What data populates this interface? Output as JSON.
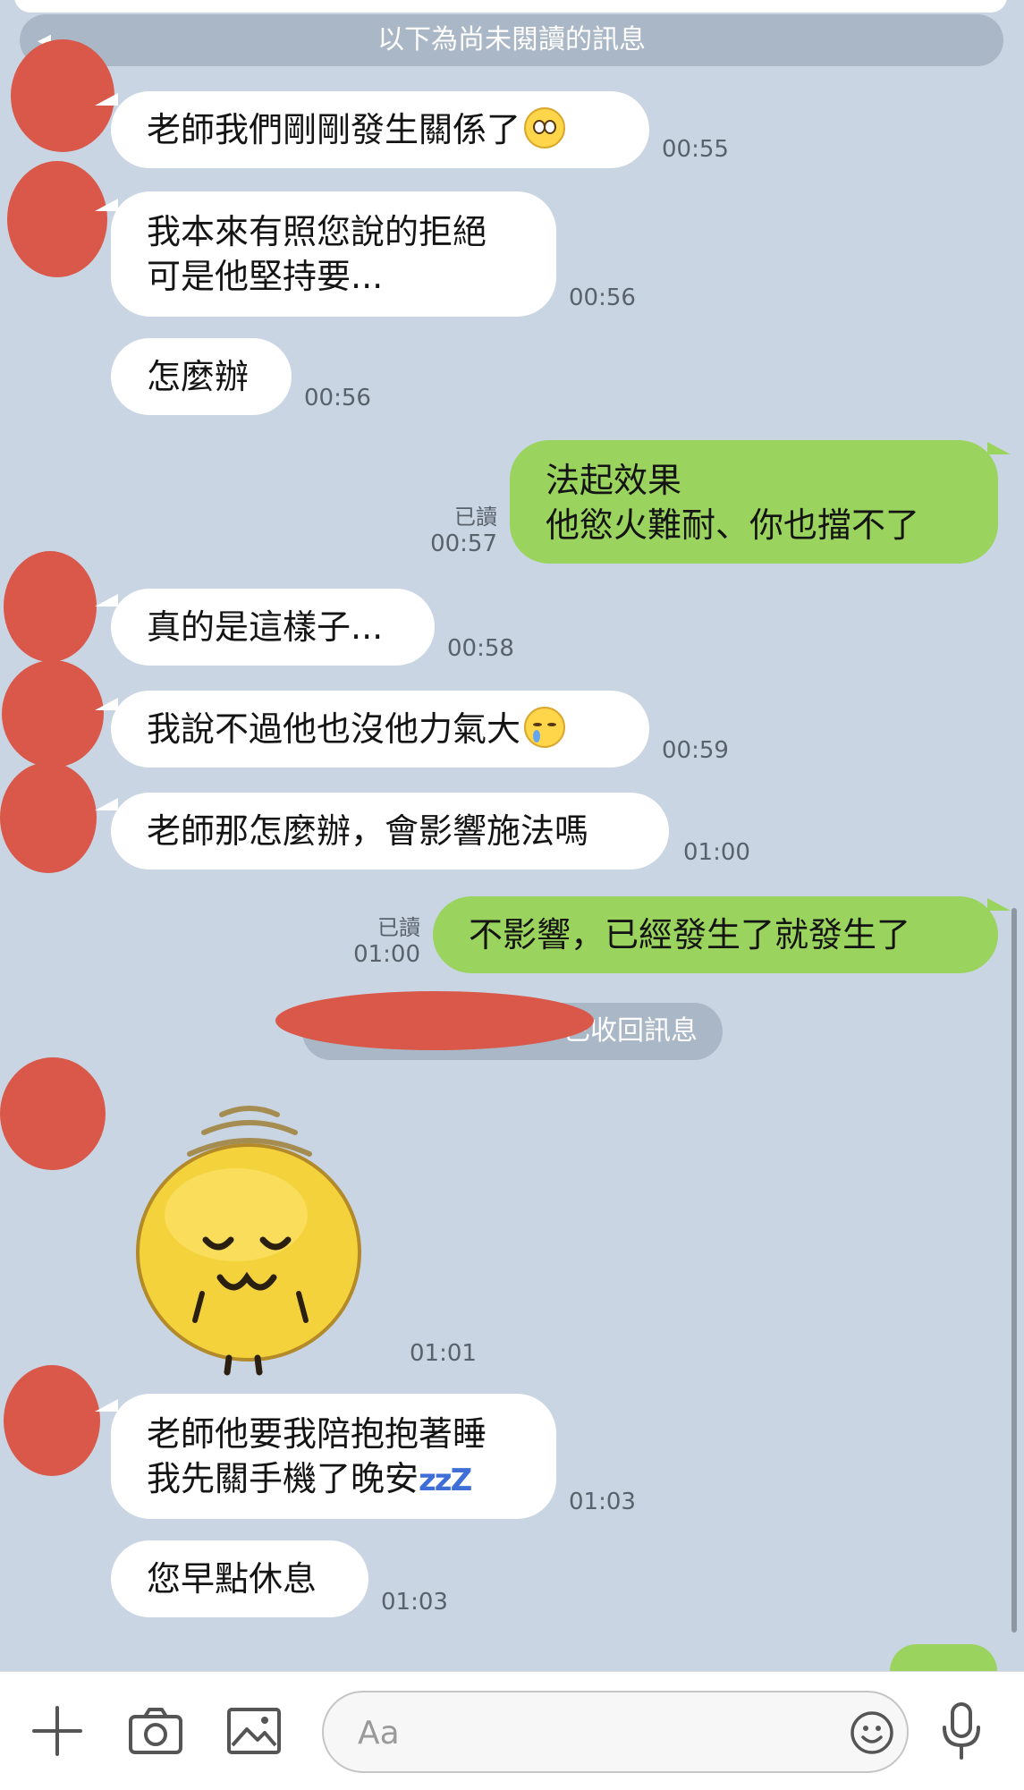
{
  "banner": {
    "unread_label": "以下為尚未閱讀的訊息"
  },
  "messages": [
    {
      "dir": "in",
      "lines": [
        "老師我們剛剛發生關係了"
      ],
      "emoji": "flushed",
      "time": "00:55"
    },
    {
      "dir": "in",
      "lines": [
        "我本來有照您說的拒絕",
        "可是他堅持要..."
      ],
      "time": "00:56"
    },
    {
      "dir": "in",
      "lines": [
        "怎麼辦"
      ],
      "time": "00:56"
    },
    {
      "dir": "out",
      "lines": [
        "法起效果",
        "他慾火難耐、你也擋不了"
      ],
      "read": "已讀",
      "time": "00:57"
    },
    {
      "dir": "in",
      "lines": [
        "真的是這樣子..."
      ],
      "time": "00:58"
    },
    {
      "dir": "in",
      "lines": [
        "我說不過他也沒他力氣大"
      ],
      "emoji": "crying",
      "time": "00:59"
    },
    {
      "dir": "in",
      "lines": [
        "老師那怎麼辦，會影響施法嗎"
      ],
      "time": "01:00"
    },
    {
      "dir": "out",
      "lines": [
        "不影響，已經發生了就發生了"
      ],
      "read": "已讀",
      "time": "01:00"
    },
    {
      "dir": "in",
      "lines": [
        "老師他要我陪抱抱著睡",
        "我先關手機了晚安"
      ],
      "emoji": "zzz",
      "time": "01:03"
    },
    {
      "dir": "in",
      "lines": [
        "您早點休息"
      ],
      "time": "01:03"
    }
  ],
  "recall_notice": "已收回訊息",
  "sticker": {
    "name": "sleepy-face-sticker",
    "time": "01:01"
  },
  "emoji_text": {
    "zzz": "zzZ"
  },
  "input": {
    "placeholder": "Aa"
  },
  "toolbar": {
    "icons": [
      "plus-icon",
      "camera-icon",
      "image-icon",
      "emoji-icon",
      "microphone-icon"
    ]
  },
  "colors": {
    "background": "#c9d5e2",
    "outgoing": "#9ad35d",
    "incoming": "#ffffff",
    "avatar_redaction": "#d9584a"
  }
}
